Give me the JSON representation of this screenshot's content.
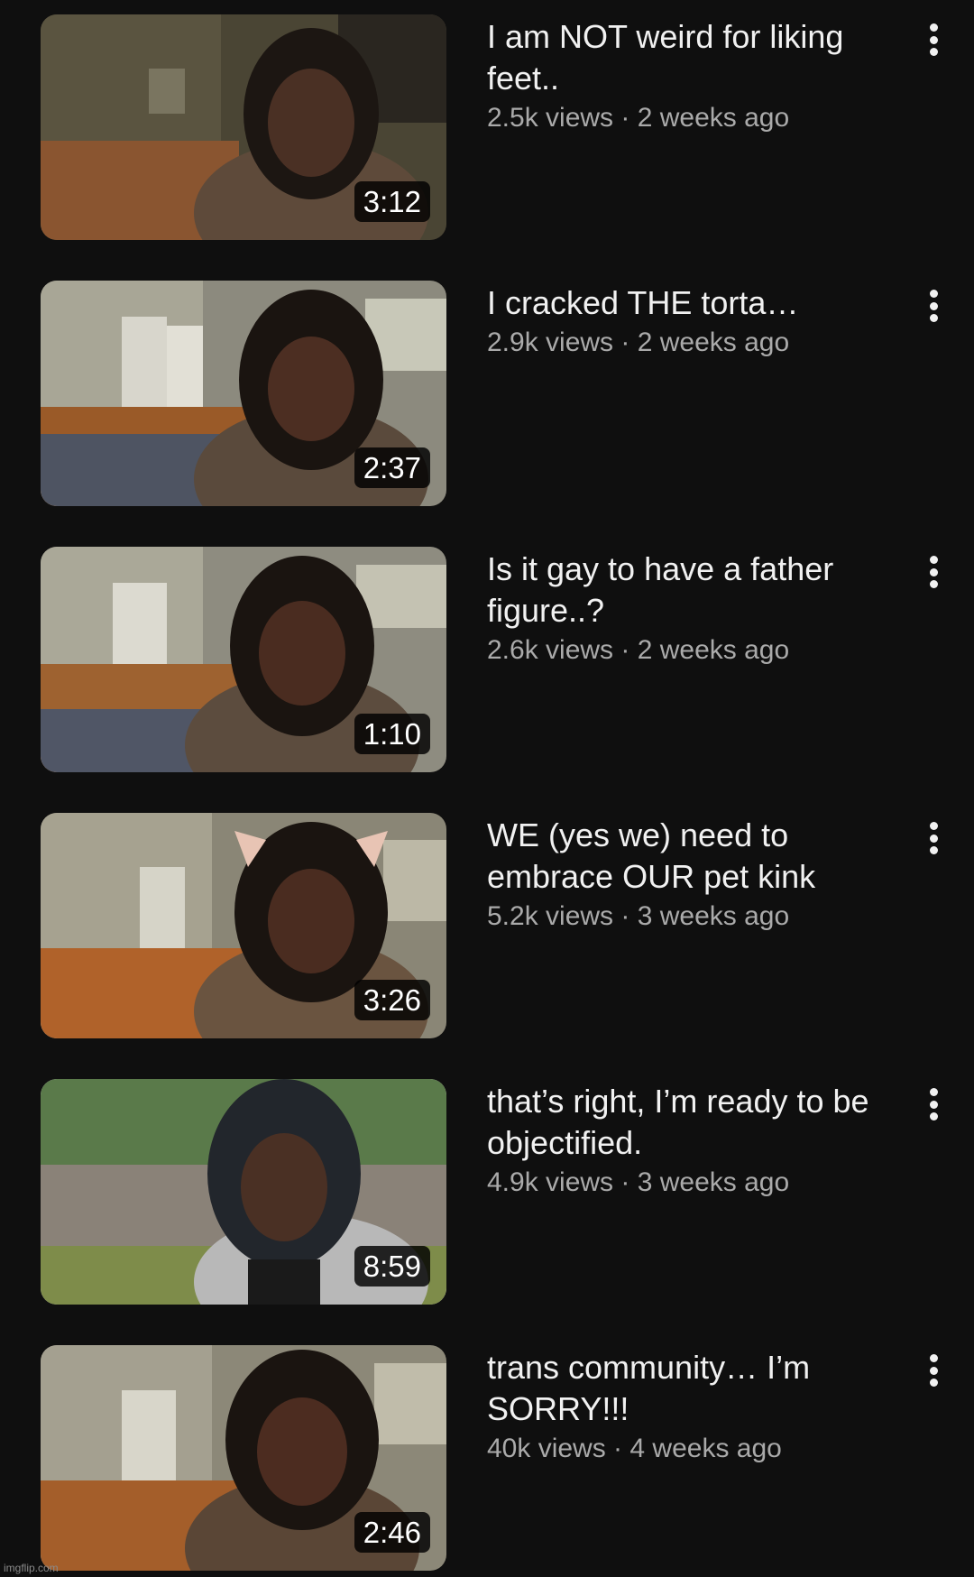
{
  "videos": [
    {
      "title": "I am NOT weird for liking feet..",
      "views": "2.5k views",
      "age": "2 weeks ago",
      "duration": "3:12"
    },
    {
      "title": "I cracked THE torta…",
      "views": "2.9k views",
      "age": "2 weeks ago",
      "duration": "2:37"
    },
    {
      "title": "Is it gay to have a father figure..?",
      "views": "2.6k views",
      "age": "2 weeks ago",
      "duration": "1:10"
    },
    {
      "title": "WE (yes we) need to embrace OUR pet kink",
      "views": "5.2k views",
      "age": "3 weeks ago",
      "duration": "3:26"
    },
    {
      "title": "that’s right, I’m ready to be objectified.",
      "views": "4.9k views",
      "age": "3 weeks ago",
      "duration": "8:59"
    },
    {
      "title": "trans community… I’m SORRY!!!",
      "views": "40k views",
      "age": "4 weeks ago",
      "duration": "2:46"
    }
  ],
  "meta_separator": " · ",
  "icons": {
    "menu": "more-vert-icon"
  },
  "colors": {
    "background": "#0f0f0f",
    "title": "#f1f1f1",
    "meta": "#aaaaaa"
  },
  "watermark": "imgflip.com"
}
